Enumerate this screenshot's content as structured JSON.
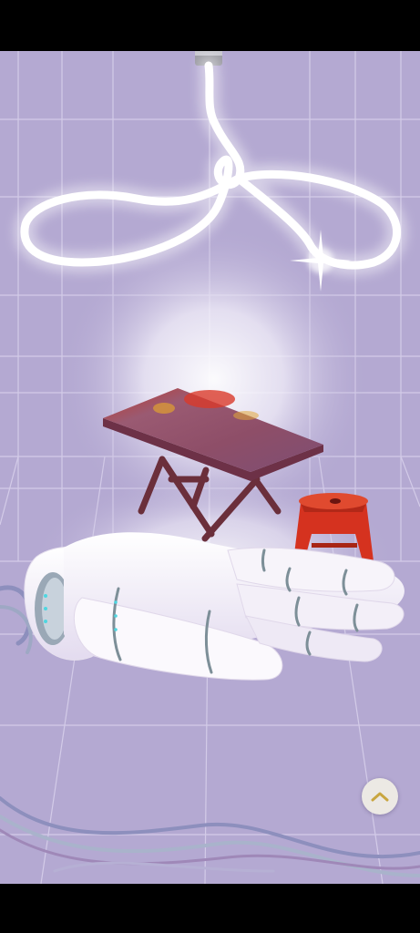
{
  "scene": {
    "description_icon": "neon-lamp-table-stool-robot-hand-illustration",
    "colors": {
      "background": "#b4a9d2",
      "grid": "#d9d2ec",
      "table_top": "#8e4e68",
      "table_legs": "#6b2f3b",
      "stool": "#d5321f",
      "hand": "#f2eef6",
      "hand_joint": "#7d8f98",
      "cables": "#8d8fbd",
      "neon": "#ffffff"
    }
  },
  "controls": {
    "scroll_up_icon": "chevron-up-icon",
    "scroll_up_color": "#c9a640"
  }
}
